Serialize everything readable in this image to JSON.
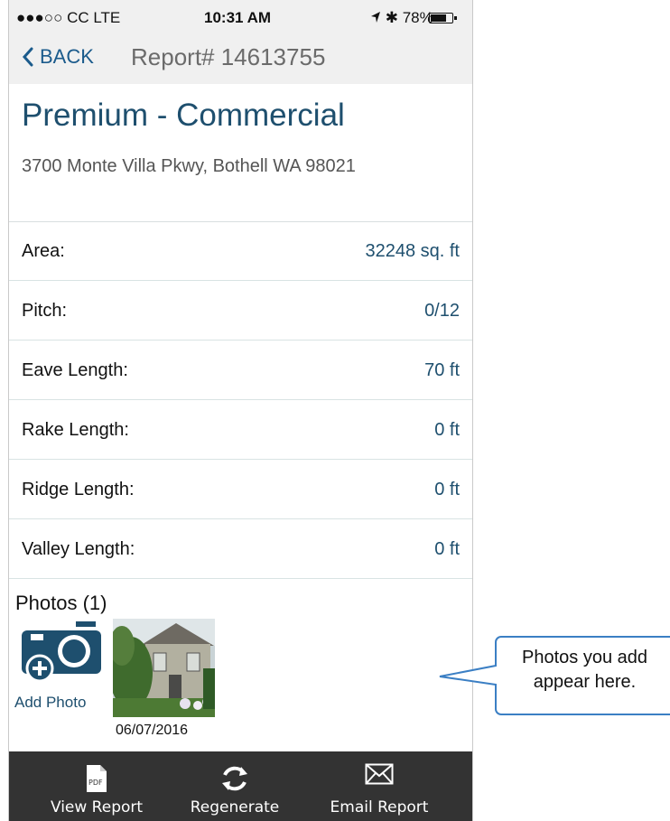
{
  "status_bar": {
    "carrier": "●●●○○ CC  LTE",
    "time": "10:31 AM",
    "battery_text": "78%",
    "battery_level": 0.78
  },
  "nav": {
    "back_label": "BACK",
    "title": "Report# 14613755"
  },
  "report": {
    "name": "Premium - Commercial",
    "address": "3700 Monte Villa Pkwy, Bothell WA 98021"
  },
  "measurements": [
    {
      "label": "Area:",
      "value": "32248 sq. ft"
    },
    {
      "label": "Pitch:",
      "value": "0/12"
    },
    {
      "label": "Eave Length:",
      "value": "70 ft"
    },
    {
      "label": "Rake Length:",
      "value": "0 ft"
    },
    {
      "label": "Ridge Length:",
      "value": "0 ft"
    },
    {
      "label": "Valley Length:",
      "value": "0 ft"
    }
  ],
  "photos": {
    "title": "Photos (1)",
    "add_label": "Add Photo",
    "items": [
      {
        "date": "06/07/2016"
      }
    ]
  },
  "toolbar": {
    "view_report": "View Report",
    "pdf_badge": "PDF",
    "regenerate": "Regenerate",
    "email_report": "Email Report"
  },
  "callout": {
    "text": "Photos you add appear here."
  },
  "colors": {
    "accent": "#1e4f6e",
    "link": "#1b5b8c",
    "toolbar_bg": "#333333",
    "nav_bg": "#f0f0f0",
    "callout_border": "#3b7fc4"
  }
}
